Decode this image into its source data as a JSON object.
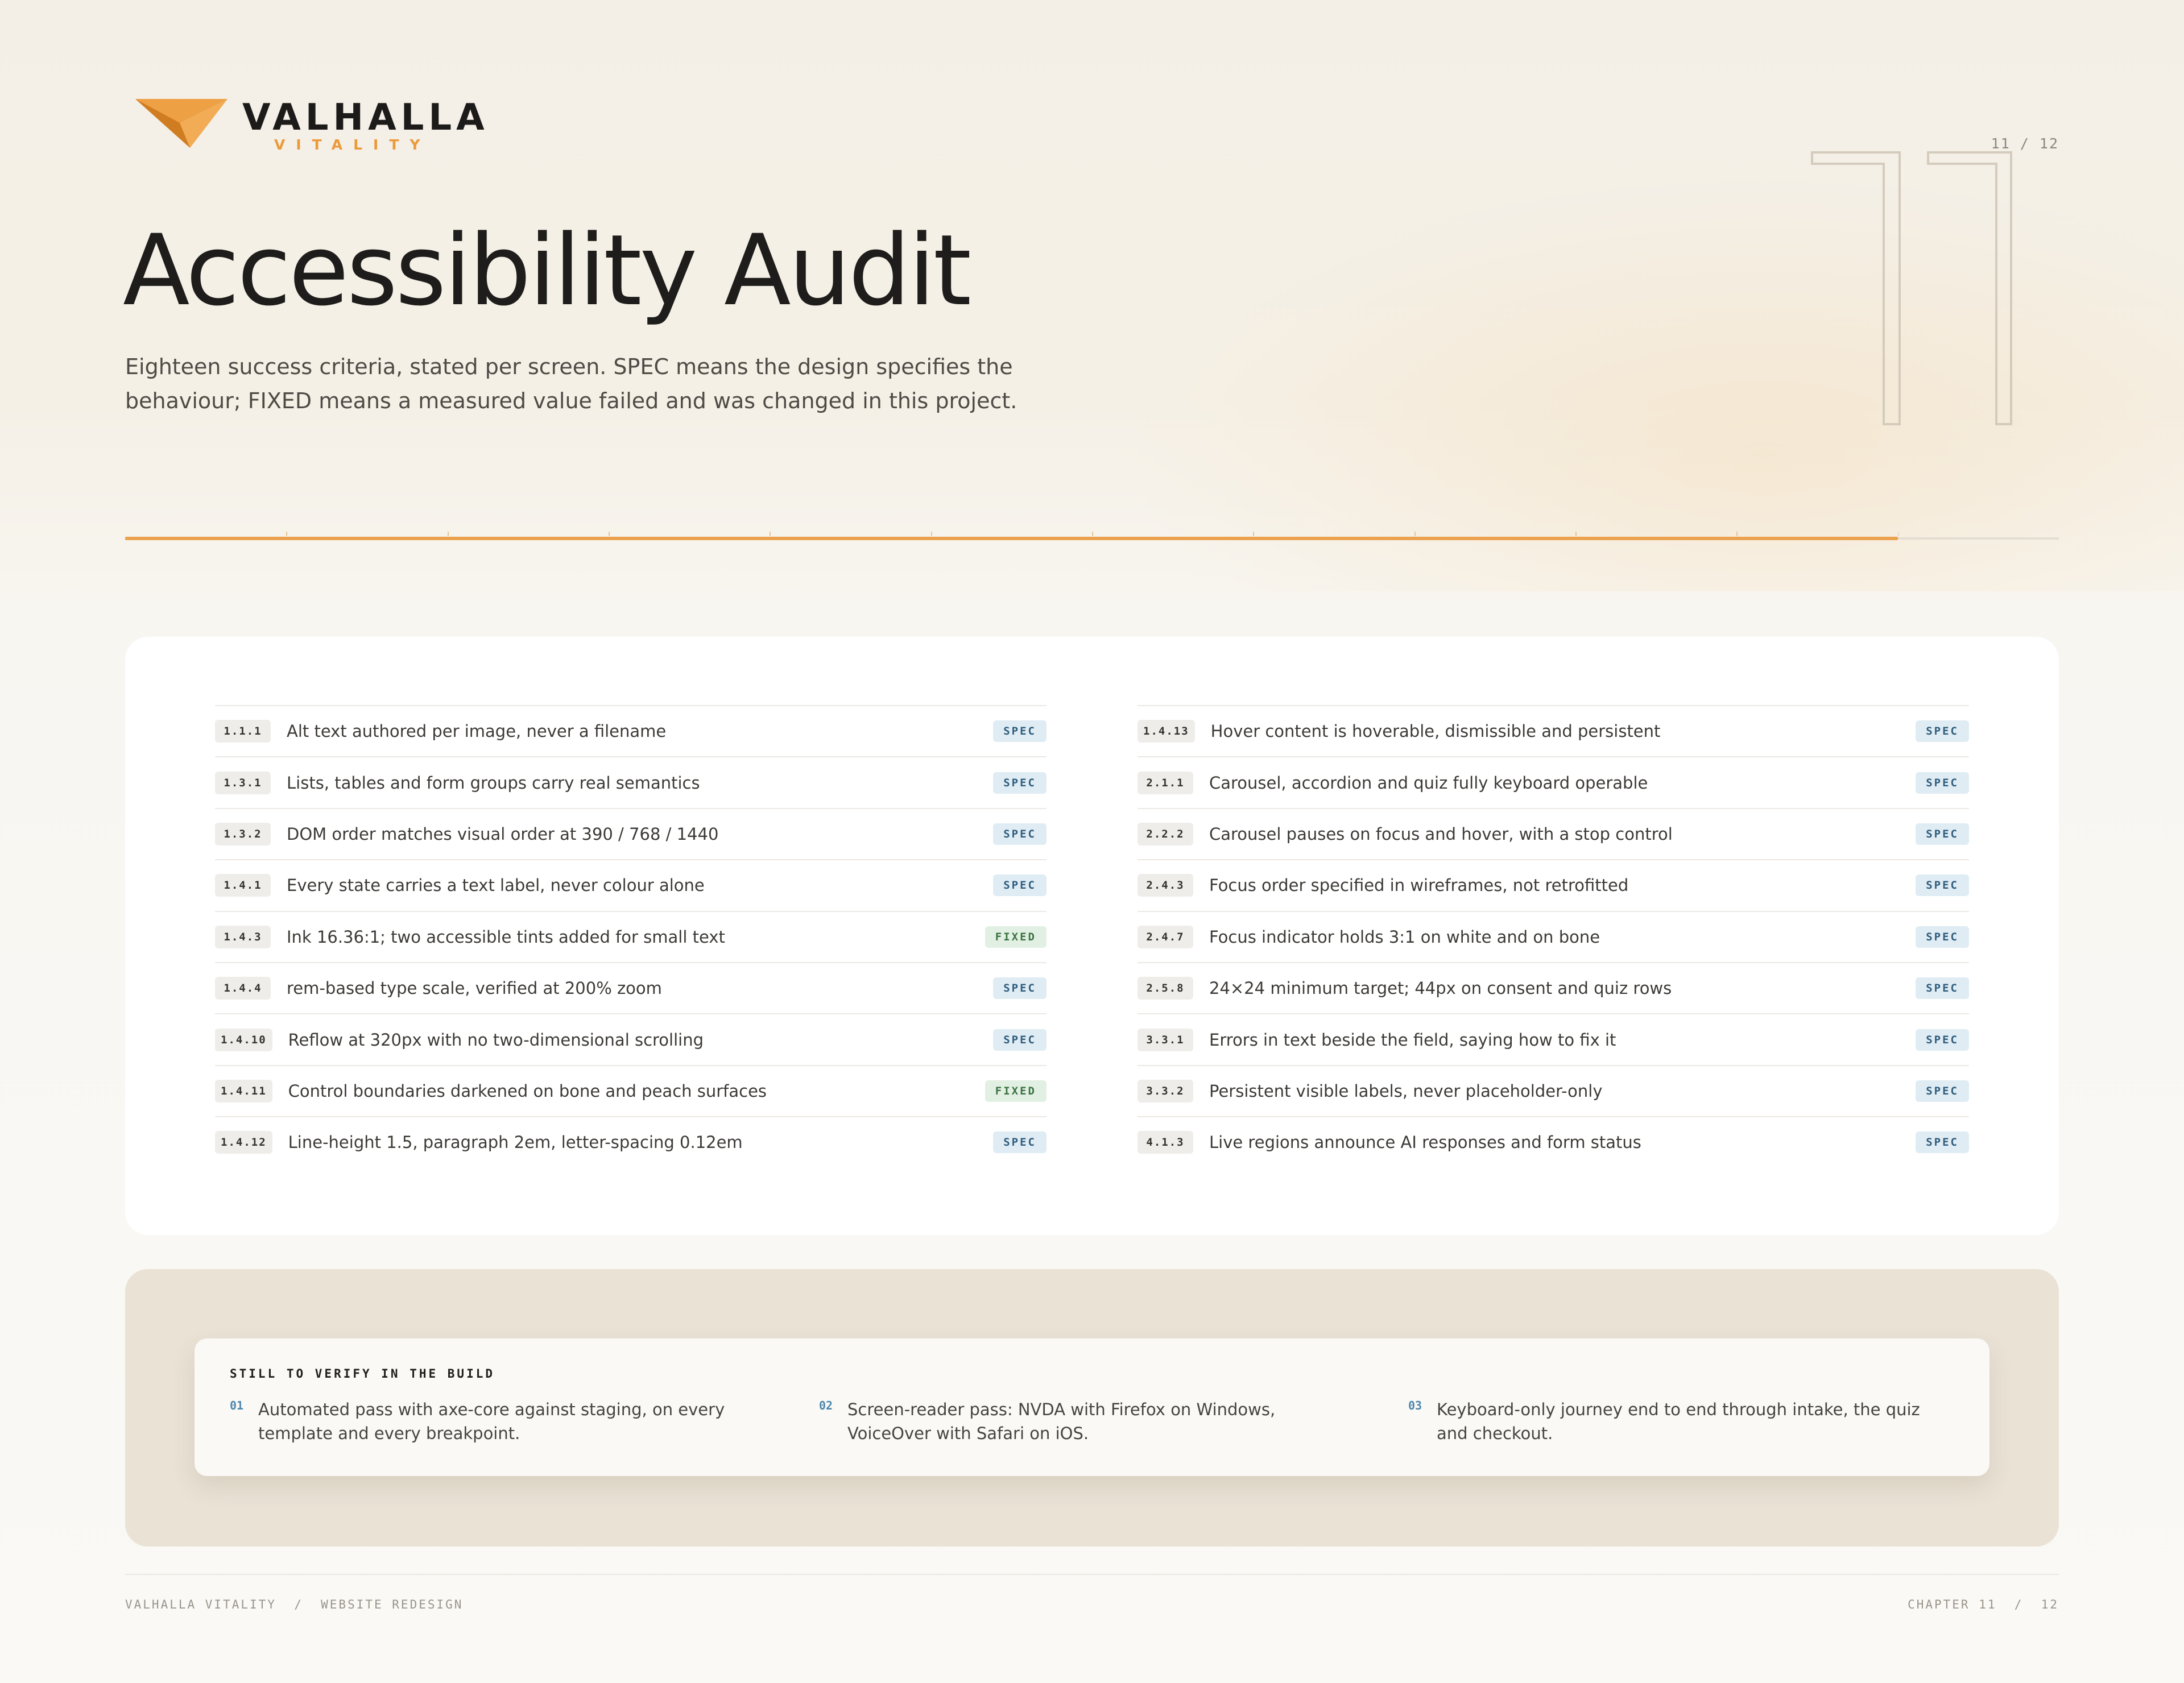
{
  "brand": {
    "name": "VALHALLA",
    "tagline": "VITALITY",
    "colors": {
      "accent": "#eb9a3a",
      "ink": "#1c1b19",
      "spec": "#2f5d7d",
      "fixed": "#3b7342"
    }
  },
  "header": {
    "page_counter": "11 / 12",
    "chapter_number": "11",
    "title": "Accessibility Audit",
    "subtitle": "Eighteen success criteria, stated per screen. SPEC means the design specifies the behaviour; FIXED means a measured value failed and was changed in this project."
  },
  "progress": {
    "current": 11,
    "total": 12
  },
  "criteria": {
    "left": [
      {
        "code": "1.1.1",
        "text": "Alt text authored per image, never a filename",
        "status": "SPEC"
      },
      {
        "code": "1.3.1",
        "text": "Lists, tables and form groups carry real semantics",
        "status": "SPEC"
      },
      {
        "code": "1.3.2",
        "text": "DOM order matches visual order at 390 / 768 / 1440",
        "status": "SPEC"
      },
      {
        "code": "1.4.1",
        "text": "Every state carries a text label, never colour alone",
        "status": "SPEC"
      },
      {
        "code": "1.4.3",
        "text": "Ink 16.36:1; two accessible tints added for small text",
        "status": "FIXED"
      },
      {
        "code": "1.4.4",
        "text": "rem-based type scale, verified at 200% zoom",
        "status": "SPEC"
      },
      {
        "code": "1.4.10",
        "text": "Reflow at 320px with no two-dimensional scrolling",
        "status": "SPEC"
      },
      {
        "code": "1.4.11",
        "text": "Control boundaries darkened on bone and peach surfaces",
        "status": "FIXED"
      },
      {
        "code": "1.4.12",
        "text": "Line-height 1.5, paragraph 2em, letter-spacing 0.12em",
        "status": "SPEC"
      }
    ],
    "right": [
      {
        "code": "1.4.13",
        "text": "Hover content is hoverable, dismissible and persistent",
        "status": "SPEC"
      },
      {
        "code": "2.1.1",
        "text": "Carousel, accordion and quiz fully keyboard operable",
        "status": "SPEC"
      },
      {
        "code": "2.2.2",
        "text": "Carousel pauses on focus and hover, with a stop control",
        "status": "SPEC"
      },
      {
        "code": "2.4.3",
        "text": "Focus order specified in wireframes, not retrofitted",
        "status": "SPEC"
      },
      {
        "code": "2.4.7",
        "text": "Focus indicator holds 3:1 on white and on bone",
        "status": "SPEC"
      },
      {
        "code": "2.5.8",
        "text": "24×24 minimum target; 44px on consent and quiz rows",
        "status": "SPEC"
      },
      {
        "code": "3.3.1",
        "text": "Errors in text beside the field, saying how to fix it",
        "status": "SPEC"
      },
      {
        "code": "3.3.2",
        "text": "Persistent visible labels, never placeholder-only",
        "status": "SPEC"
      },
      {
        "code": "4.1.3",
        "text": "Live regions announce AI responses and form status",
        "status": "SPEC"
      }
    ]
  },
  "verify": {
    "title": "STILL TO VERIFY IN THE BUILD",
    "items": [
      {
        "num": "01",
        "text": "Automated pass with axe-core against staging, on every template and every breakpoint."
      },
      {
        "num": "02",
        "text": "Screen-reader pass: NVDA with Firefox on Windows, VoiceOver with Safari on iOS."
      },
      {
        "num": "03",
        "text": "Keyboard-only journey end to end through intake, the quiz and checkout."
      }
    ]
  },
  "footer": {
    "left": "VALHALLA VITALITY  /  WEBSITE REDESIGN",
    "right": "CHAPTER 11  /  12"
  }
}
